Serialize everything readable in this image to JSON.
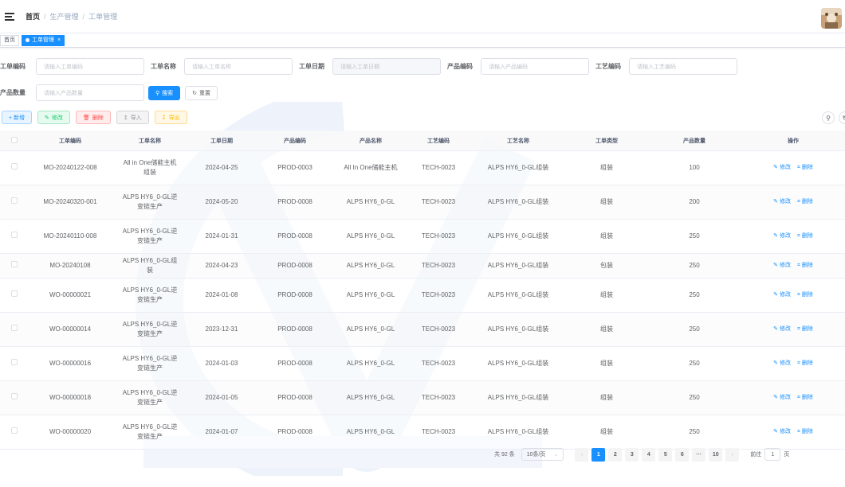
{
  "navbar": {
    "breadcrumb": [
      "首页",
      "生产管理",
      "工单管理"
    ],
    "breadcrumb_sep": "/"
  },
  "tags": {
    "home": "首页",
    "active": "工单管理",
    "close": "×"
  },
  "search": {
    "fields": [
      {
        "label": "工单编码",
        "placeholder": "请输入工单编码"
      },
      {
        "label": "工单名称",
        "placeholder": "请输入工单名称"
      },
      {
        "label": "工单日期",
        "placeholder": "请输入工单日期"
      },
      {
        "label": "产品编码",
        "placeholder": "请输入产品编码"
      },
      {
        "label": "工艺编码",
        "placeholder": "请输入工艺编码"
      },
      {
        "label": "产品数量",
        "placeholder": "请输入产品数量"
      }
    ],
    "search_label": "搜索",
    "search_icon": "search-icon",
    "reset_label": "重置",
    "reset_icon": "refresh-icon"
  },
  "toolbar": {
    "add": "+ 新增",
    "edit": "修改",
    "delete": "删除",
    "import": "导入",
    "export": "导出"
  },
  "table": {
    "columns": [
      "工单编码",
      "工单名称",
      "工单日期",
      "产品编码",
      "产品名称",
      "工艺编码",
      "工艺名称",
      "工单类型",
      "产品数量",
      "操作"
    ],
    "rows": [
      {
        "code": "MO-20240122-008",
        "name": "All in One储能主机组装",
        "date": "2024-04-25",
        "product_code": "PROD-0003",
        "product_name": "All In One储能主机",
        "process_code": "TECH-0023",
        "process_name": "ALPS HY6_0-GL组装",
        "type": "组装",
        "qty": "100"
      },
      {
        "code": "MO-20240320-001",
        "name": "ALPS HY6_0-GL逆变链生产",
        "date": "2024-05-20",
        "product_code": "PROD-0008",
        "product_name": "ALPS HY6_0-GL",
        "process_code": "TECH-0023",
        "process_name": "ALPS HY6_0-GL组装",
        "type": "组装",
        "qty": "200"
      },
      {
        "code": "MO-20240110-008",
        "name": "ALPS HY6_0-GL逆变链生产",
        "date": "2024-01-31",
        "product_code": "PROD-0008",
        "product_name": "ALPS HY6_0-GL",
        "process_code": "TECH-0023",
        "process_name": "ALPS HY6_0-GL组装",
        "type": "组装",
        "qty": "250"
      },
      {
        "code": "MO-20240108",
        "name": "ALPS HY6_0-GL组装",
        "date": "2024-04-23",
        "product_code": "PROD-0008",
        "product_name": "ALPS HY6_0-GL",
        "process_code": "TECH-0023",
        "process_name": "ALPS HY6_0-GL组装",
        "type": "包装",
        "qty": "250"
      },
      {
        "code": "WO-00000021",
        "name": "ALPS HY6_0-GL逆变链生产",
        "date": "2024-01-08",
        "product_code": "PROD-0008",
        "product_name": "ALPS HY6_0-GL",
        "process_code": "TECH-0023",
        "process_name": "ALPS HY6_0-GL组装",
        "type": "组装",
        "qty": "250"
      },
      {
        "code": "WO-00000014",
        "name": "ALPS HY6_0-GL逆变链生产",
        "date": "2023-12-31",
        "product_code": "PROD-0008",
        "product_name": "ALPS HY6_0-GL",
        "process_code": "TECH-0023",
        "process_name": "ALPS HY6_0-GL组装",
        "type": "组装",
        "qty": "250"
      },
      {
        "code": "WO-00000016",
        "name": "ALPS HY6_0-GL逆变链生产",
        "date": "2024-01-03",
        "product_code": "PROD-0008",
        "product_name": "ALPS HY6_0-GL",
        "process_code": "TECH-0023",
        "process_name": "ALPS HY6_0-GL组装",
        "type": "组装",
        "qty": "250"
      },
      {
        "code": "WO-00000018",
        "name": "ALPS HY6_0-GL逆变链生产",
        "date": "2024-01-05",
        "product_code": "PROD-0008",
        "product_name": "ALPS HY6_0-GL",
        "process_code": "TECH-0023",
        "process_name": "ALPS HY6_0-GL组装",
        "type": "组装",
        "qty": "250"
      },
      {
        "code": "WO-00000020",
        "name": "ALPS HY6_0-GL逆变链生产",
        "date": "2024-01-07",
        "product_code": "PROD-0008",
        "product_name": "ALPS HY6_0-GL",
        "process_code": "TECH-0023",
        "process_name": "ALPS HY6_0-GL组装",
        "type": "组装",
        "qty": "250"
      }
    ],
    "edit_label": "修改",
    "delete_label": "删除"
  },
  "pagination": {
    "total": "共 92 条",
    "page_size": "10条/页",
    "pages": [
      "1",
      "2",
      "3",
      "4",
      "5",
      "6",
      "···",
      "10"
    ],
    "current": "1",
    "goto": "前往",
    "goto_value": "1",
    "goto_suffix": "页"
  },
  "colors": {
    "primary": "#1890ff",
    "success": "#13ce66",
    "danger": "#ff4949",
    "warning": "#ffba00",
    "info": "#909399"
  }
}
